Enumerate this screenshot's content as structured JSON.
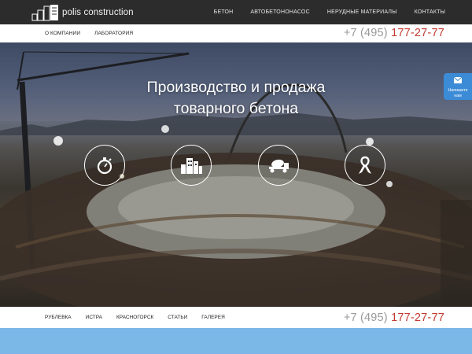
{
  "header": {
    "logo_text": "polis construction",
    "nav": [
      "БЕТОН",
      "АВТОБЕТОНОНАСОС",
      "НЕРУДНЫЕ МАТЕРИАЛЫ",
      "КОНТАКТЫ"
    ]
  },
  "subnav": {
    "items": [
      "О КОМПАНИИ",
      "ЛАБОРАТОРИЯ"
    ],
    "phone_prefix": "+7 (495)",
    "phone_number": "177-27-77"
  },
  "hero": {
    "title_line1": "Производство и продажа",
    "title_line2": "товарного бетона",
    "features": [
      "stopwatch-icon",
      "buildings-icon",
      "concrete-mixer-truck-icon",
      "ribbon-icon"
    ]
  },
  "feedback": {
    "label_line1": "Напишите",
    "label_line2": "нам"
  },
  "footer": {
    "nav": [
      "РУБЛЕВКА",
      "ИСТРА",
      "КРАСНОГОРСК",
      "СТАТЬИ",
      "ГАЛЕРЕЯ"
    ],
    "phone_prefix": "+7 (495)",
    "phone_number": "177-27-77"
  },
  "colors": {
    "topbar": "#2c2c2c",
    "phone_accent": "#c33a32",
    "feedback": "#3c8bd6",
    "bottom_band": "#7bb8e8"
  }
}
